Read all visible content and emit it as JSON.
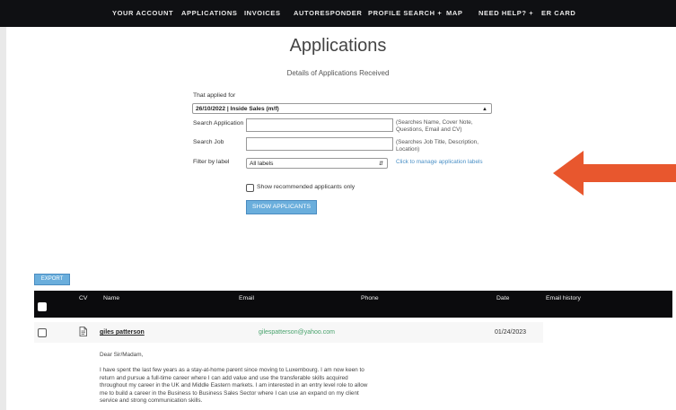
{
  "nav": {
    "items": [
      "YOUR ACCOUNT",
      "APPLICATIONS",
      "INVOICES",
      "AUTORESPONDER",
      "PROFILE SEARCH +",
      "MAP",
      "NEED HELP? +",
      "ER CARD"
    ]
  },
  "page": {
    "title": "Applications",
    "subtitle": "Details of Applications Received"
  },
  "form": {
    "applied_for_label": "That applied for",
    "applied_for_value": "26/10/2022 | Inside Sales (m/f)",
    "search_application_label": "Search Application",
    "search_application_hint": "(Searches Name, Cover Note, Questions, Email and CV)",
    "search_job_label": "Search Job",
    "search_job_hint": "(Searches Job Title, Description, Location)",
    "filter_label": "Filter by label",
    "filter_value": "All labels",
    "manage_labels_link": "Click to manage application labels",
    "recommended_label": "Show recommended applicants only",
    "show_button": "SHOW APPLICANTS"
  },
  "table": {
    "export_button": "EXPORT",
    "headers": {
      "cv": "CV",
      "name": "Name",
      "email": "Email",
      "phone": "Phone",
      "date": "Date",
      "email_history": "Email history"
    },
    "rows": [
      {
        "name": "giles patterson",
        "email": "gilespatterson@yahoo.com",
        "date": "01/24/2023"
      }
    ]
  },
  "letter": {
    "greeting": "Dear Sir/Madam,",
    "lines": [
      "I have spent the last few years as a stay-at-home parent since moving to Luxembourg. I am now keen to",
      "return and pursue a full-time career where I can add value and use the transferable skills acquired",
      "throughout my career in the UK and Middle Eastern markets. I am interested in an entry level role to allow",
      "me to build a career in the Business to Business Sales Sector where I can use an expand on my client",
      "service and strong communication skills."
    ]
  },
  "colors": {
    "nav_bg": "#0f1013",
    "accent_blue": "#6aaedc",
    "arrow": "#e8572e",
    "email_green": "#4aa36e"
  }
}
